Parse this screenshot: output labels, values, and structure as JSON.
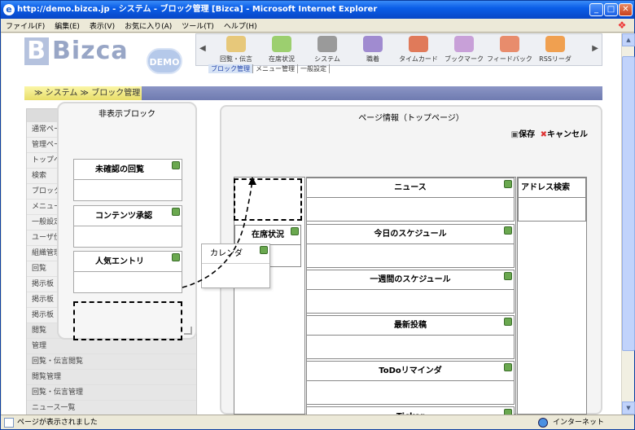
{
  "window": {
    "title": "http://demo.bizca.jp - システム - ブロック管理 [Bizca] - Microsoft Internet Explorer",
    "min": "_",
    "max": "□",
    "close": "✕"
  },
  "menu": [
    "ファイル(F)",
    "編集(E)",
    "表示(V)",
    "お気に入り(A)",
    "ツール(T)",
    "ヘルプ(H)"
  ],
  "header": {
    "logo": "Bizca",
    "demo_badge": "DEMO",
    "apps": [
      "回覧・伝言",
      "在席状況",
      "システム",
      "職着",
      "タイムカード",
      "ブックマーク",
      "フィードバック",
      "RSSリーダ"
    ],
    "subtabs": [
      "ブロック管理",
      "メニュー管理",
      "一般設定"
    ]
  },
  "breadcrumb": {
    "system": "システム",
    "block_admin": "ブロック管理"
  },
  "leftmenu": [
    "通常ペー",
    "管理ペー",
    "トップペ",
    "検索",
    "ブロック",
    "メニュー",
    "一般設定",
    "ユーザ仕",
    "組織管理",
    "回覧",
    "掲示板",
    "掲示板",
    "掲示板",
    "閲覧",
    "管理",
    "回覧・伝言閲覧",
    "閲覧管理",
    "回覧・伝言管理",
    "ニュース一覧"
  ],
  "hidden_panel": {
    "title": "非表示ブロック",
    "blocks": [
      "未確認の回覧",
      "コンテンツ承認",
      "人気エントリ"
    ]
  },
  "dragged_block": "カレンダ",
  "page_info": {
    "title": "ページ情報（トップページ）",
    "save": "保存",
    "cancel": "キャンセル",
    "left_block": "在席状況",
    "center_blocks": [
      "ニュース",
      "今日のスケジュール",
      "一週間のスケジュール",
      "最新投稿",
      "ToDoリマインダ",
      "Ticker"
    ],
    "right_block": "アドレス検索"
  },
  "status": {
    "text": "ページが表示されました",
    "zone": "インターネット"
  }
}
